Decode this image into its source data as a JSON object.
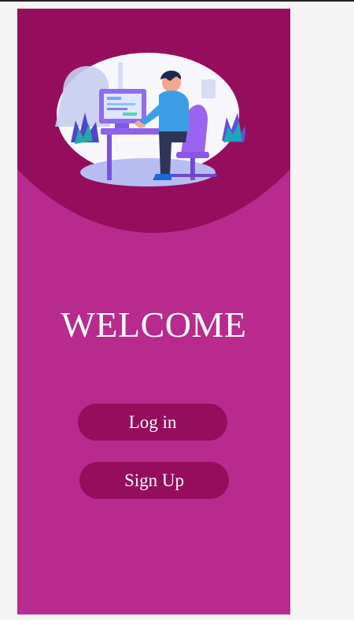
{
  "welcome": {
    "title": "WELCOME"
  },
  "actions": {
    "login_label": "Log in",
    "signup_label": "Sign Up"
  },
  "illustration": {
    "name": "person-working-at-desk-illustration"
  },
  "colors": {
    "page_background": "#f4f4f4",
    "panel_background": "#b92a8e",
    "header_background": "#950e5d",
    "button_background": "#950e5d",
    "text": "#ffffff"
  }
}
